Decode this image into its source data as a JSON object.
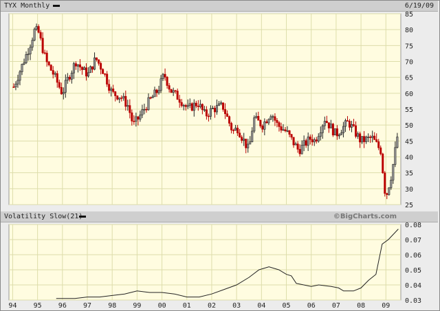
{
  "header": {
    "title": "TYX Monthly",
    "date": "6/19/09"
  },
  "lower_header": {
    "title": "Volatility Slow(21)",
    "credit": "©BigCharts.com"
  },
  "colors": {
    "up": "#222222",
    "down": "#bb0000",
    "plot_bg": "#fffce0",
    "grid": "#ddddaa",
    "line": "#222222"
  },
  "chart_data": [
    {
      "type": "candlestick",
      "title": "TYX Monthly",
      "ylim": [
        25,
        85
      ],
      "yticks": [
        25,
        30,
        35,
        40,
        45,
        50,
        55,
        60,
        65,
        70,
        75,
        80,
        85
      ],
      "xlim": [
        1993.85,
        2009.6
      ],
      "xticks": [
        "94",
        "95",
        "96",
        "97",
        "98",
        "99",
        "00",
        "01",
        "02",
        "03",
        "04",
        "05",
        "06",
        "07",
        "08",
        "09"
      ],
      "close_anchors": [
        [
          1994.0,
          62
        ],
        [
          1994.3,
          68
        ],
        [
          1994.6,
          74
        ],
        [
          1994.85,
          80
        ],
        [
          1995.0,
          79
        ],
        [
          1995.3,
          70
        ],
        [
          1995.6,
          66
        ],
        [
          1995.95,
          60
        ],
        [
          1996.2,
          65
        ],
        [
          1996.5,
          70
        ],
        [
          1996.8,
          67
        ],
        [
          1997.0,
          66
        ],
        [
          1997.3,
          71
        ],
        [
          1997.6,
          67
        ],
        [
          1997.95,
          60
        ],
        [
          1998.3,
          59
        ],
        [
          1998.6,
          56
        ],
        [
          1998.8,
          50
        ],
        [
          1999.0,
          52
        ],
        [
          1999.4,
          57
        ],
        [
          1999.8,
          61
        ],
        [
          2000.05,
          66
        ],
        [
          2000.3,
          61
        ],
        [
          2000.7,
          58
        ],
        [
          2001.0,
          55
        ],
        [
          2001.4,
          57
        ],
        [
          2001.7,
          53
        ],
        [
          2002.0,
          55
        ],
        [
          2002.4,
          56
        ],
        [
          2002.8,
          48
        ],
        [
          2003.0,
          49
        ],
        [
          2003.45,
          42
        ],
        [
          2003.65,
          52
        ],
        [
          2004.0,
          50
        ],
        [
          2004.35,
          54
        ],
        [
          2004.6,
          50
        ],
        [
          2004.95,
          48
        ],
        [
          2005.45,
          42
        ],
        [
          2005.95,
          46
        ],
        [
          2006.1,
          45
        ],
        [
          2006.5,
          52
        ],
        [
          2006.95,
          47
        ],
        [
          2007.45,
          51
        ],
        [
          2007.95,
          45
        ],
        [
          2008.4,
          46
        ],
        [
          2008.75,
          42
        ],
        [
          2008.95,
          27
        ],
        [
          2009.2,
          35
        ],
        [
          2009.45,
          48
        ]
      ]
    },
    {
      "type": "line",
      "title": "Volatility Slow(21)",
      "ylim": [
        0.03,
        0.08
      ],
      "yticks": [
        0.03,
        0.04,
        0.05,
        0.06,
        0.07,
        0.08
      ],
      "xticks": [
        "94",
        "95",
        "96",
        "97",
        "98",
        "99",
        "00",
        "01",
        "02",
        "03",
        "04",
        "05",
        "06",
        "07",
        "08",
        "09"
      ],
      "points": [
        [
          1995.75,
          0.031
        ],
        [
          1996.0,
          0.031
        ],
        [
          1996.5,
          0.031
        ],
        [
          1997.0,
          0.032
        ],
        [
          1997.5,
          0.032
        ],
        [
          1998.0,
          0.033
        ],
        [
          1998.5,
          0.034
        ],
        [
          1999.0,
          0.036
        ],
        [
          1999.5,
          0.035
        ],
        [
          2000.0,
          0.035
        ],
        [
          2000.5,
          0.034
        ],
        [
          2001.0,
          0.032
        ],
        [
          2001.5,
          0.032
        ],
        [
          2002.0,
          0.034
        ],
        [
          2002.5,
          0.037
        ],
        [
          2003.0,
          0.04
        ],
        [
          2003.5,
          0.045
        ],
        [
          2003.9,
          0.05
        ],
        [
          2004.3,
          0.052
        ],
        [
          2004.7,
          0.05
        ],
        [
          2005.0,
          0.047
        ],
        [
          2005.2,
          0.046
        ],
        [
          2005.4,
          0.041
        ],
        [
          2005.7,
          0.04
        ],
        [
          2006.0,
          0.039
        ],
        [
          2006.3,
          0.04
        ],
        [
          2006.8,
          0.039
        ],
        [
          2007.1,
          0.038
        ],
        [
          2007.3,
          0.036
        ],
        [
          2007.7,
          0.036
        ],
        [
          2008.0,
          0.038
        ],
        [
          2008.3,
          0.043
        ],
        [
          2008.6,
          0.047
        ],
        [
          2008.85,
          0.067
        ],
        [
          2009.1,
          0.07
        ],
        [
          2009.5,
          0.077
        ]
      ]
    }
  ]
}
